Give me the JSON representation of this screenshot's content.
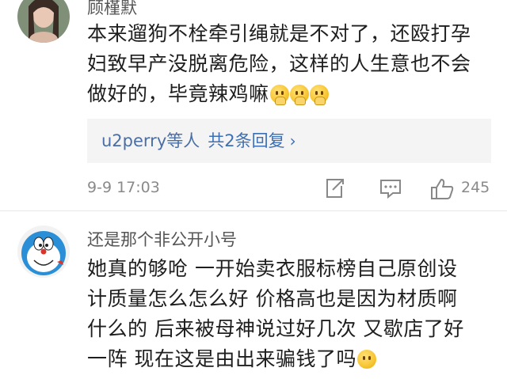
{
  "comments": [
    {
      "username": "顾槿默",
      "text_lines": [
        "本来遛狗不栓牵引绳就是不对了，还殴打孕",
        "妇致早产没脱离危险，这样的人生意也不会",
        "做好的，毕竟辣鸡嘛"
      ],
      "emojis": [
        "hand-over-mouth-emoji",
        "hand-over-mouth-emoji",
        "hand-over-mouth-emoji"
      ],
      "replies": {
        "who": "u2perry等人",
        "count_label": "共2条回复",
        "chevron": "›"
      },
      "timestamp": "9-9 17:03",
      "like_count": "245"
    },
    {
      "username": "还是那个非公开小号",
      "text_lines": [
        "她真的够呛 一开始卖衣服标榜自己原创设",
        "计质量怎么怎么好 价格高也是因为材质啊",
        "什么的 后来被母神说过好几次 又歇店了好",
        "一阵 现在这是由出来骗钱了吗"
      ],
      "emojis": [
        "sweat-smile-emoji"
      ]
    }
  ],
  "colors": {
    "link": "#3d6fb6",
    "muted": "#8a8a8a",
    "reply_bg": "#f4f4f4"
  }
}
